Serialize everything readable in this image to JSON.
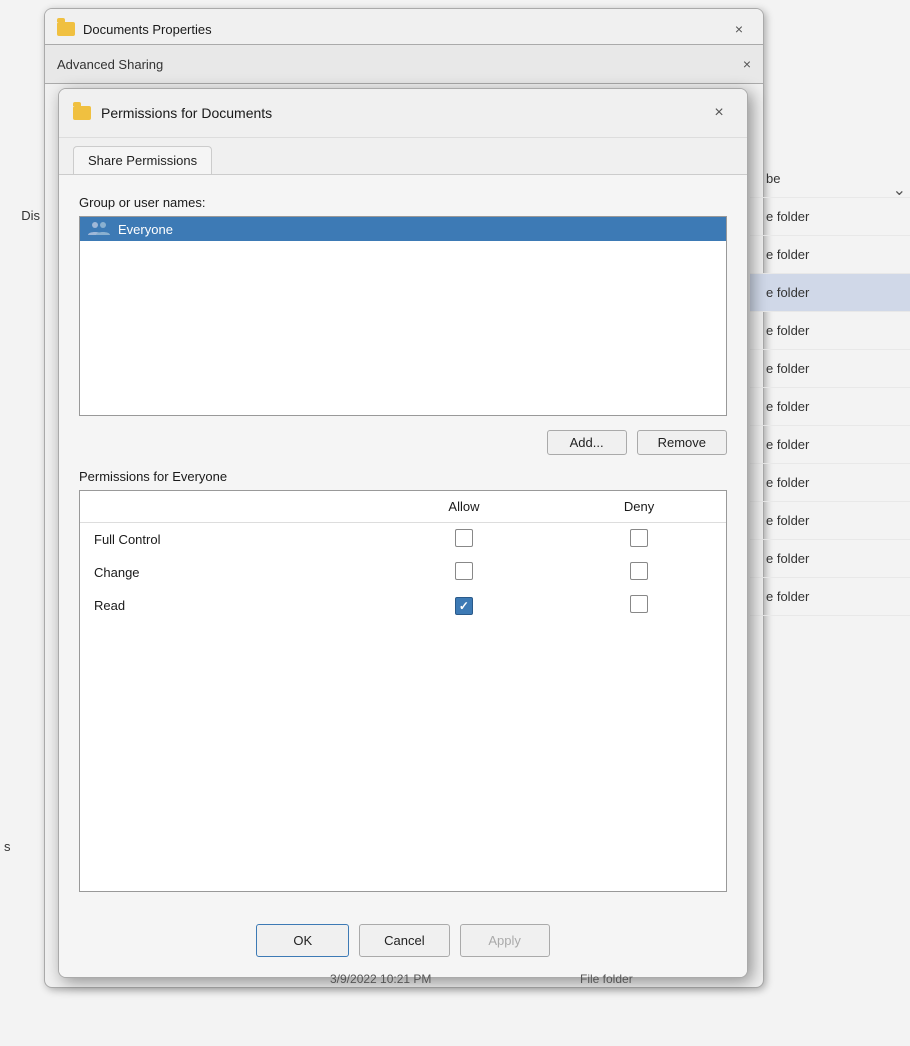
{
  "background": {
    "color": "#c8c8c8"
  },
  "docs_properties": {
    "title": "Documents Properties",
    "folder_icon": "folder-icon",
    "close_label": "×"
  },
  "advanced_sharing": {
    "title": "Advanced Sharing"
  },
  "sidebar": {
    "items": [
      {
        "label": "be"
      },
      {
        "label": "e folder"
      },
      {
        "label": "e folder"
      },
      {
        "label": "e folder",
        "highlighted": true
      },
      {
        "label": "e folder"
      },
      {
        "label": "e folder"
      },
      {
        "label": "e folder"
      },
      {
        "label": "e folder"
      },
      {
        "label": "e folder"
      },
      {
        "label": "e folder"
      },
      {
        "label": "e folder"
      },
      {
        "label": "e folder"
      }
    ],
    "left_label": "Dis",
    "bottom_left": "s"
  },
  "permissions_dialog": {
    "title": "Permissions for Documents",
    "close_label": "×",
    "folder_icon": "folder-icon",
    "tabs": [
      {
        "label": "Share Permissions",
        "active": true
      }
    ],
    "group_label": "Group or user names:",
    "users": [
      {
        "name": "Everyone",
        "selected": true
      }
    ],
    "add_button": "Add...",
    "remove_button": "Remove",
    "permissions_label": "Permissions for Everyone",
    "permissions_columns": {
      "permission": "",
      "allow": "Allow",
      "deny": "Deny"
    },
    "permissions_rows": [
      {
        "name": "Full Control",
        "allow": false,
        "deny": false
      },
      {
        "name": "Change",
        "allow": false,
        "deny": false
      },
      {
        "name": "Read",
        "allow": true,
        "deny": false
      }
    ],
    "ok_label": "OK",
    "cancel_label": "Cancel",
    "apply_label": "Apply"
  }
}
